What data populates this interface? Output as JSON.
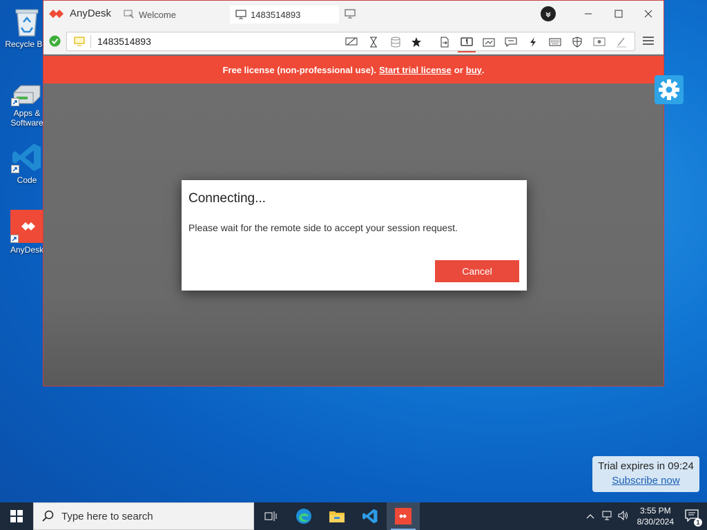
{
  "desktop": {
    "icons": [
      {
        "label": "Recycle Bin"
      },
      {
        "label": "Apps & Software"
      },
      {
        "label": "Code"
      },
      {
        "label": "AnyDesk"
      }
    ]
  },
  "window": {
    "app_name": "AnyDesk",
    "tabs": [
      {
        "label": "Welcome"
      },
      {
        "label": "1483514893"
      }
    ],
    "address": {
      "value": "1483514893"
    },
    "banner": {
      "prefix": "Free license (non-professional use).",
      "trial_link": "Start trial license",
      "middle": "or",
      "buy_link": "buy",
      "suffix": "."
    },
    "dialog": {
      "title": "Connecting...",
      "message": "Please wait for the remote side to accept your session request.",
      "cancel_label": "Cancel"
    }
  },
  "trial_notice": {
    "text": "Trial expires in 09:24",
    "link": "Subscribe now"
  },
  "taskbar": {
    "search_placeholder": "Type here to search",
    "time": "3:55 PM",
    "date": "8/30/2024"
  },
  "colors": {
    "accent_red": "#ef4a37",
    "desktop_blue": "#1177d4",
    "taskbar": "#1c2a3b"
  }
}
